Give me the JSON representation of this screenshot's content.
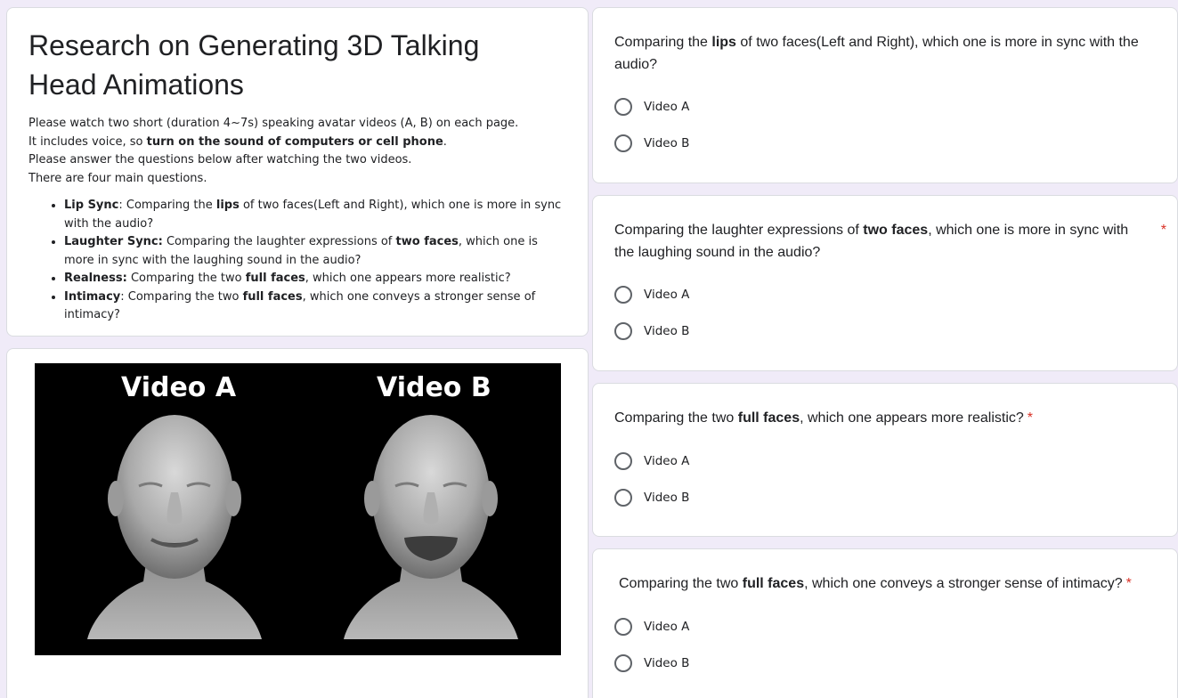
{
  "form": {
    "title": "Research on Generating 3D Talking Head Animations",
    "description": [
      {
        "before": "Please watch two short (duration 4~7s) speaking avatar videos (A, B) on each page.",
        "bold": "",
        "after": ""
      },
      {
        "before": "It includes voice, so ",
        "bold": "turn on the sound of computers or cell phone",
        "after": "."
      },
      {
        "before": "Please answer the questions below after watching the two videos.",
        "bold": "",
        "after": ""
      },
      {
        "before": "There are four main questions.",
        "bold": "",
        "after": ""
      }
    ],
    "bullets": [
      {
        "label": "Lip Sync",
        "text_1": ": Comparing the ",
        "bold": "lips",
        "text_2": " of two faces(Left and Right), which one is more in sync with the audio?"
      },
      {
        "label": "Laughter Sync:",
        "text_1": " Comparing the laughter expressions of ",
        "bold": "two faces",
        "text_2": ", which one is more in sync with the laughing sound in the audio?"
      },
      {
        "label": "Realness:",
        "text_1": " Comparing the two ",
        "bold": "full faces",
        "text_2": ", which one appears more realistic?"
      },
      {
        "label": "Intimacy",
        "text_1": ": Comparing the two ",
        "bold": "full faces",
        "text_2": ", which one conveys a stronger sense of intimacy?"
      }
    ]
  },
  "video": {
    "label_a": "Video A",
    "label_b": "Video B",
    "frame_color": "#000000"
  },
  "questions": [
    {
      "text_1": "Comparing the ",
      "bold": "lips",
      "text_2": " of two faces(Left and Right), which one is more in sync with the audio?",
      "required": "",
      "options": [
        "Video A",
        "Video B"
      ]
    },
    {
      "text_1": "Comparing the laughter expressions of ",
      "bold": "two faces",
      "text_2": ", which one is more in sync with the laughing sound in the audio?",
      "required": "*",
      "options": [
        "Video A",
        "Video B"
      ]
    },
    {
      "text_1": "Comparing the two ",
      "bold": "full faces",
      "text_2": ", which one appears more realistic?",
      "required": "*",
      "options": [
        "Video A",
        "Video B"
      ]
    },
    {
      "text_1": "Comparing the two ",
      "bold": "full faces",
      "text_2": ", which one conveys a stronger sense of intimacy?",
      "required": "*",
      "options": [
        "Video A",
        "Video B"
      ]
    }
  ],
  "colors": {
    "page_background": "#f0ebf8",
    "required_asterisk": "#d93025",
    "radio_border": "#5f6368"
  }
}
